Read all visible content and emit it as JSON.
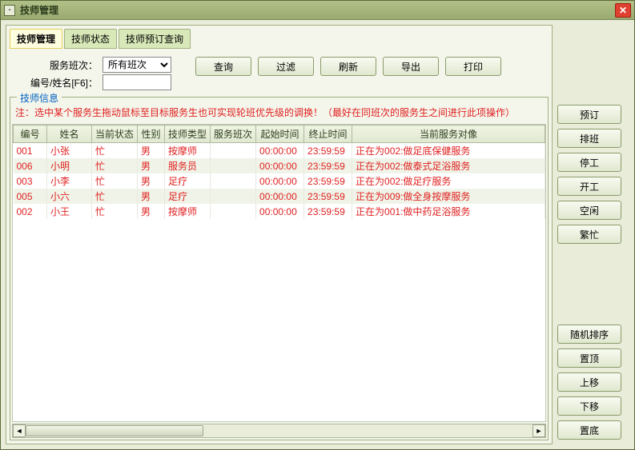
{
  "window": {
    "title": "技师管理"
  },
  "tabs": [
    "技师管理",
    "技师状态",
    "技师预订查询"
  ],
  "active_tab": 0,
  "filters": {
    "shift_label": "服务班次：",
    "shift_value": "所有班次",
    "id_label": "编号/姓名[F6]：",
    "id_value": ""
  },
  "toolbar": {
    "query": "查询",
    "filter": "过滤",
    "refresh": "刷新",
    "export": "导出",
    "print": "打印"
  },
  "fieldset_title": "技师信息",
  "note": "注：选中某个服务生拖动鼠标至目标服务生也可实现轮班优先级的调换！（最好在同班次的服务生之间进行此项操作）",
  "columns": [
    "编号",
    "姓名",
    "当前状态",
    "性别",
    "技师类型",
    "服务班次",
    "起始时间",
    "终止时间",
    "当前服务对像"
  ],
  "rows": [
    {
      "id": "001",
      "name": "小张",
      "status": "忙",
      "gender": "男",
      "type": "按摩师",
      "shift": "",
      "start": "00:00:00",
      "end": "23:59:59",
      "target": "正在为002:做足底保健服务"
    },
    {
      "id": "006",
      "name": "小明",
      "status": "忙",
      "gender": "男",
      "type": "服务员",
      "shift": "",
      "start": "00:00:00",
      "end": "23:59:59",
      "target": "正在为002:做泰式足浴服务"
    },
    {
      "id": "003",
      "name": "小李",
      "status": "忙",
      "gender": "男",
      "type": "足疗",
      "shift": "",
      "start": "00:00:00",
      "end": "23:59:59",
      "target": "正在为002:做足疗服务"
    },
    {
      "id": "005",
      "name": "小六",
      "status": "忙",
      "gender": "男",
      "type": "足疗",
      "shift": "",
      "start": "00:00:00",
      "end": "23:59:59",
      "target": "正在为009:做全身按摩服务"
    },
    {
      "id": "002",
      "name": "小王",
      "status": "忙",
      "gender": "男",
      "type": "按摩师",
      "shift": "",
      "start": "00:00:00",
      "end": "23:59:59",
      "target": "正在为001:做中药足浴服务"
    }
  ],
  "side_buttons_top": [
    {
      "key": "reserve",
      "label": "预订"
    },
    {
      "key": "schedule",
      "label": "排班"
    },
    {
      "key": "stop",
      "label": "停工"
    },
    {
      "key": "start",
      "label": "开工"
    },
    {
      "key": "idle",
      "label": "空闲"
    },
    {
      "key": "busy",
      "label": "繁忙"
    }
  ],
  "side_buttons_bottom": [
    {
      "key": "random",
      "label": "随机排序"
    },
    {
      "key": "top",
      "label": "置顶"
    },
    {
      "key": "up",
      "label": "上移"
    },
    {
      "key": "down",
      "label": "下移"
    },
    {
      "key": "bottom",
      "label": "置底"
    }
  ]
}
